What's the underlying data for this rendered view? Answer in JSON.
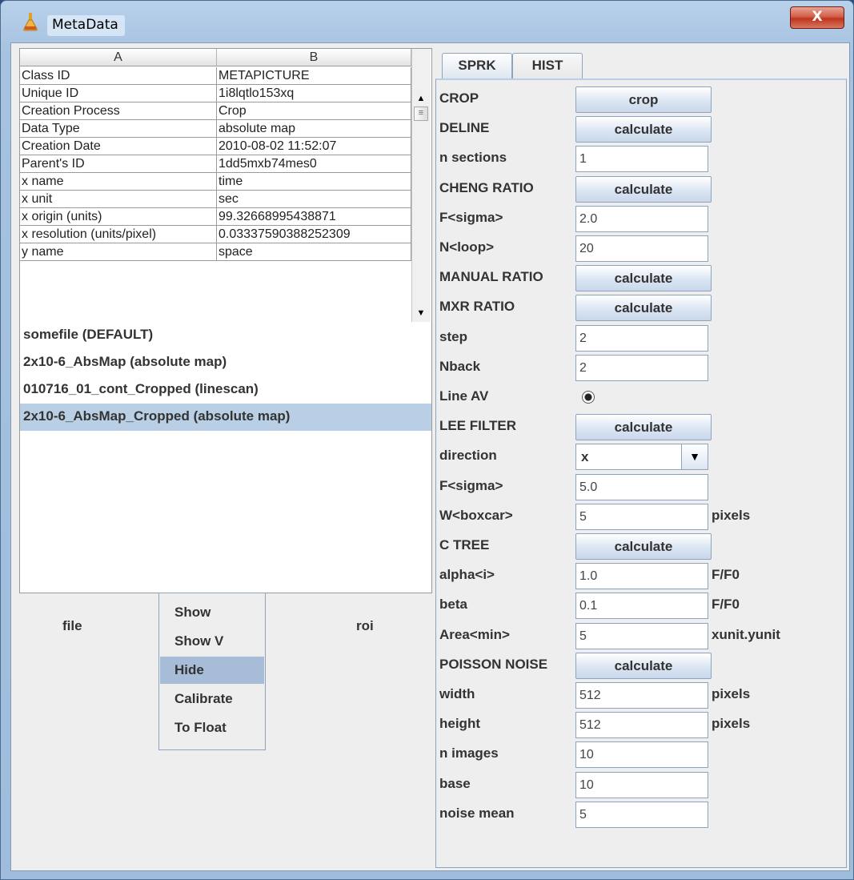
{
  "window": {
    "title": "MetaData",
    "close_glyph": "X"
  },
  "table": {
    "headers": [
      "A",
      "B"
    ],
    "rows": [
      [
        "Class ID",
        "METAPICTURE"
      ],
      [
        "Unique ID",
        "1i8lqtlo153xq"
      ],
      [
        "Creation Process",
        "Crop"
      ],
      [
        "Data Type",
        "absolute map"
      ],
      [
        "Creation Date",
        "2010-08-02 11:52:07"
      ],
      [
        "Parent's ID",
        "1dd5mxb74mes0"
      ],
      [
        "x name",
        "time"
      ],
      [
        "x unit",
        "sec"
      ],
      [
        "x origin (units)",
        "99.32668995438871"
      ],
      [
        "x resolution (units/pixel)",
        "0.03337590388252309"
      ],
      [
        "y name",
        "space"
      ]
    ]
  },
  "file_list": {
    "items": [
      "somefile (DEFAULT)",
      "2x10-6_AbsMap (absolute map)",
      "010716_01_cont_Cropped (linescan)",
      "2x10-6_AbsMap_Cropped (absolute map)"
    ],
    "selected_index": 3
  },
  "bottom": {
    "file_label": "file",
    "roi_label": "roi",
    "menu": [
      "Show",
      "Show V",
      "Hide",
      "Calibrate",
      "To Float"
    ],
    "menu_selected": 2
  },
  "tabs": [
    "SPRK",
    "HIST"
  ],
  "active_tab": "SPRK",
  "params": [
    {
      "label": "CROP",
      "type": "button",
      "value": "crop"
    },
    {
      "label": "DELINE",
      "type": "button",
      "value": "calculate"
    },
    {
      "label": "n sections",
      "type": "field",
      "value": "1"
    },
    {
      "label": "CHENG RATIO",
      "type": "button",
      "value": "calculate"
    },
    {
      "label": "F<sigma>",
      "type": "field",
      "value": "2.0"
    },
    {
      "label": "N<loop>",
      "type": "field",
      "value": "20"
    },
    {
      "label": "MANUAL RATIO",
      "type": "button",
      "value": "calculate"
    },
    {
      "label": "MXR RATIO",
      "type": "button",
      "value": "calculate"
    },
    {
      "label": "step",
      "type": "field",
      "value": "2"
    },
    {
      "label": "Nback",
      "type": "field",
      "value": "2"
    },
    {
      "label": "Line AV",
      "type": "radio",
      "checked": true
    },
    {
      "label": "LEE FILTER",
      "type": "button",
      "value": "calculate"
    },
    {
      "label": "direction",
      "type": "select",
      "value": "x"
    },
    {
      "label": "F<sigma>",
      "type": "field",
      "value": "5.0"
    },
    {
      "label": "W<boxcar>",
      "type": "field",
      "value": "5",
      "unit": "pixels"
    },
    {
      "label": "C TREE",
      "type": "button",
      "value": "calculate"
    },
    {
      "label": "alpha<i>",
      "type": "field",
      "value": "1.0",
      "unit": "F/F0"
    },
    {
      "label": "beta",
      "type": "field",
      "value": "0.1",
      "unit": "F/F0"
    },
    {
      "label": "Area<min>",
      "type": "field",
      "value": "5",
      "unit": "xunit.yunit"
    },
    {
      "label": "POISSON NOISE",
      "type": "button",
      "value": "calculate"
    },
    {
      "label": "width",
      "type": "field",
      "value": "512",
      "unit": "pixels"
    },
    {
      "label": "height",
      "type": "field",
      "value": "512",
      "unit": "pixels"
    },
    {
      "label": "n images",
      "type": "field",
      "value": "10"
    },
    {
      "label": "base",
      "type": "field",
      "value": "10"
    },
    {
      "label": "noise mean",
      "type": "field",
      "value": "5"
    }
  ]
}
